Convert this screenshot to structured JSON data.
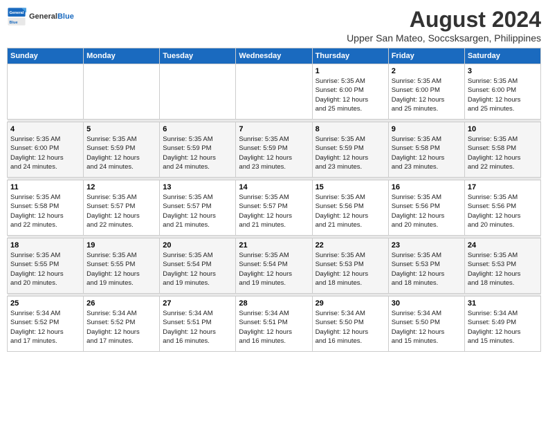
{
  "logo": {
    "line1": "General",
    "line2": "Blue"
  },
  "title": "August 2024",
  "subtitle": "Upper San Mateo, Soccsksargen, Philippines",
  "days_header": [
    "Sunday",
    "Monday",
    "Tuesday",
    "Wednesday",
    "Thursday",
    "Friday",
    "Saturday"
  ],
  "weeks": [
    {
      "cells": [
        {
          "day": "",
          "text": ""
        },
        {
          "day": "",
          "text": ""
        },
        {
          "day": "",
          "text": ""
        },
        {
          "day": "",
          "text": ""
        },
        {
          "day": "1",
          "text": "Sunrise: 5:35 AM\nSunset: 6:00 PM\nDaylight: 12 hours\nand 25 minutes."
        },
        {
          "day": "2",
          "text": "Sunrise: 5:35 AM\nSunset: 6:00 PM\nDaylight: 12 hours\nand 25 minutes."
        },
        {
          "day": "3",
          "text": "Sunrise: 5:35 AM\nSunset: 6:00 PM\nDaylight: 12 hours\nand 25 minutes."
        }
      ]
    },
    {
      "cells": [
        {
          "day": "4",
          "text": "Sunrise: 5:35 AM\nSunset: 6:00 PM\nDaylight: 12 hours\nand 24 minutes."
        },
        {
          "day": "5",
          "text": "Sunrise: 5:35 AM\nSunset: 5:59 PM\nDaylight: 12 hours\nand 24 minutes."
        },
        {
          "day": "6",
          "text": "Sunrise: 5:35 AM\nSunset: 5:59 PM\nDaylight: 12 hours\nand 24 minutes."
        },
        {
          "day": "7",
          "text": "Sunrise: 5:35 AM\nSunset: 5:59 PM\nDaylight: 12 hours\nand 23 minutes."
        },
        {
          "day": "8",
          "text": "Sunrise: 5:35 AM\nSunset: 5:59 PM\nDaylight: 12 hours\nand 23 minutes."
        },
        {
          "day": "9",
          "text": "Sunrise: 5:35 AM\nSunset: 5:58 PM\nDaylight: 12 hours\nand 23 minutes."
        },
        {
          "day": "10",
          "text": "Sunrise: 5:35 AM\nSunset: 5:58 PM\nDaylight: 12 hours\nand 22 minutes."
        }
      ]
    },
    {
      "cells": [
        {
          "day": "11",
          "text": "Sunrise: 5:35 AM\nSunset: 5:58 PM\nDaylight: 12 hours\nand 22 minutes."
        },
        {
          "day": "12",
          "text": "Sunrise: 5:35 AM\nSunset: 5:57 PM\nDaylight: 12 hours\nand 22 minutes."
        },
        {
          "day": "13",
          "text": "Sunrise: 5:35 AM\nSunset: 5:57 PM\nDaylight: 12 hours\nand 21 minutes."
        },
        {
          "day": "14",
          "text": "Sunrise: 5:35 AM\nSunset: 5:57 PM\nDaylight: 12 hours\nand 21 minutes."
        },
        {
          "day": "15",
          "text": "Sunrise: 5:35 AM\nSunset: 5:56 PM\nDaylight: 12 hours\nand 21 minutes."
        },
        {
          "day": "16",
          "text": "Sunrise: 5:35 AM\nSunset: 5:56 PM\nDaylight: 12 hours\nand 20 minutes."
        },
        {
          "day": "17",
          "text": "Sunrise: 5:35 AM\nSunset: 5:56 PM\nDaylight: 12 hours\nand 20 minutes."
        }
      ]
    },
    {
      "cells": [
        {
          "day": "18",
          "text": "Sunrise: 5:35 AM\nSunset: 5:55 PM\nDaylight: 12 hours\nand 20 minutes."
        },
        {
          "day": "19",
          "text": "Sunrise: 5:35 AM\nSunset: 5:55 PM\nDaylight: 12 hours\nand 19 minutes."
        },
        {
          "day": "20",
          "text": "Sunrise: 5:35 AM\nSunset: 5:54 PM\nDaylight: 12 hours\nand 19 minutes."
        },
        {
          "day": "21",
          "text": "Sunrise: 5:35 AM\nSunset: 5:54 PM\nDaylight: 12 hours\nand 19 minutes."
        },
        {
          "day": "22",
          "text": "Sunrise: 5:35 AM\nSunset: 5:53 PM\nDaylight: 12 hours\nand 18 minutes."
        },
        {
          "day": "23",
          "text": "Sunrise: 5:35 AM\nSunset: 5:53 PM\nDaylight: 12 hours\nand 18 minutes."
        },
        {
          "day": "24",
          "text": "Sunrise: 5:35 AM\nSunset: 5:53 PM\nDaylight: 12 hours\nand 18 minutes."
        }
      ]
    },
    {
      "cells": [
        {
          "day": "25",
          "text": "Sunrise: 5:34 AM\nSunset: 5:52 PM\nDaylight: 12 hours\nand 17 minutes."
        },
        {
          "day": "26",
          "text": "Sunrise: 5:34 AM\nSunset: 5:52 PM\nDaylight: 12 hours\nand 17 minutes."
        },
        {
          "day": "27",
          "text": "Sunrise: 5:34 AM\nSunset: 5:51 PM\nDaylight: 12 hours\nand 16 minutes."
        },
        {
          "day": "28",
          "text": "Sunrise: 5:34 AM\nSunset: 5:51 PM\nDaylight: 12 hours\nand 16 minutes."
        },
        {
          "day": "29",
          "text": "Sunrise: 5:34 AM\nSunset: 5:50 PM\nDaylight: 12 hours\nand 16 minutes."
        },
        {
          "day": "30",
          "text": "Sunrise: 5:34 AM\nSunset: 5:50 PM\nDaylight: 12 hours\nand 15 minutes."
        },
        {
          "day": "31",
          "text": "Sunrise: 5:34 AM\nSunset: 5:49 PM\nDaylight: 12 hours\nand 15 minutes."
        }
      ]
    }
  ]
}
